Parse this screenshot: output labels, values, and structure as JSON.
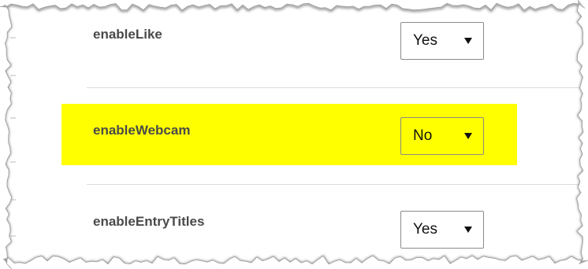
{
  "settings": [
    {
      "label": "enableLike",
      "value": "Yes",
      "highlighted": false
    },
    {
      "label": "enableWebcam",
      "value": "No",
      "highlighted": true
    },
    {
      "label": "enableEntryTitles",
      "value": "Yes",
      "highlighted": false
    }
  ],
  "colors": {
    "highlight": "#ffff00",
    "label_text": "#4a4a4a",
    "divider": "#dcdcdc",
    "select_border": "#8a8a8a"
  },
  "icons": {
    "dropdown": "chevron-down-icon"
  }
}
